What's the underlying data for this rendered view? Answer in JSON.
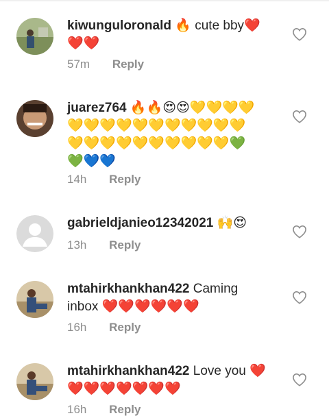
{
  "comments": [
    {
      "username": "kiwunguloronald",
      "text": "🔥 cute bby❤️\n❤️❤️",
      "time": "57m",
      "reply": "Reply"
    },
    {
      "username": "juarez764",
      "text": "🔥🔥😍😍💛💛💛💛\n💛💛💛💛💛💛💛💛💛💛💛\n💛💛💛💛💛💛💛💛💛💛💚\n💚💙💙",
      "time": "14h",
      "reply": "Reply"
    },
    {
      "username": "gabrieldjanieo12342021",
      "text": "🙌😍",
      "time": "13h",
      "reply": "Reply"
    },
    {
      "username": "mtahirkhankhan422",
      "text": "Caming\ninbox ❤️❤️❤️❤️❤️❤️",
      "time": "16h",
      "reply": "Reply"
    },
    {
      "username": "mtahirkhankhan422",
      "text": "Love you ❤️\n❤️❤️❤️❤️❤️❤️❤️",
      "time": "16h",
      "reply": "Reply"
    }
  ],
  "icons": {
    "like": "heart-outline-icon",
    "avatar_placeholder": "default-avatar-icon"
  },
  "colors": {
    "meta": "#8e8e8e",
    "heart_outline": "#8e8e8e",
    "avatar_placeholder": "#dbdbdb"
  }
}
